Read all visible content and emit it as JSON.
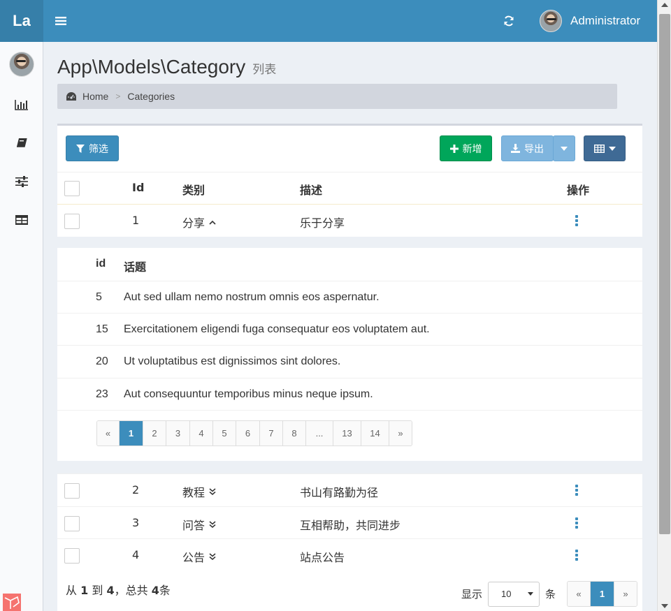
{
  "header": {
    "logo": "La",
    "user_name": "Administrator"
  },
  "sidebar": {
    "items": [
      {
        "icon": "bar-chart-icon"
      },
      {
        "icon": "book-icon"
      },
      {
        "icon": "sliders-icon"
      },
      {
        "icon": "table-icon"
      }
    ]
  },
  "page": {
    "title": "App\\Models\\Category",
    "subtitle": "列表"
  },
  "breadcrumb": {
    "home": "Home",
    "current": "Categories"
  },
  "toolbar": {
    "filter_label": "筛选",
    "new_label": "新增",
    "export_label": "导出"
  },
  "table": {
    "headers": {
      "id": "Id",
      "category": "类别",
      "description": "描述",
      "actions": "操作"
    },
    "rows": [
      {
        "id": "1",
        "category": "分享",
        "description": "乐于分享"
      },
      {
        "id": "2",
        "category": "教程",
        "description": "书山有路勤为径"
      },
      {
        "id": "3",
        "category": "问答",
        "description": "互相帮助，共同进步"
      },
      {
        "id": "4",
        "category": "公告",
        "description": "站点公告"
      }
    ]
  },
  "subtable": {
    "headers": {
      "id": "id",
      "topic": "话题"
    },
    "rows": [
      {
        "id": "5",
        "title": "Aut sed ullam nemo nostrum omnis eos aspernatur."
      },
      {
        "id": "15",
        "title": "Exercitationem eligendi fuga consequatur eos voluptatem aut."
      },
      {
        "id": "20",
        "title": "Ut voluptatibus est dignissimos sint dolores."
      },
      {
        "id": "23",
        "title": "Aut consequuntur temporibus minus neque ipsum."
      }
    ],
    "pages": [
      "«",
      "1",
      "2",
      "3",
      "4",
      "5",
      "6",
      "7",
      "8",
      "...",
      "13",
      "14",
      "»"
    ],
    "active_page": "1"
  },
  "footer": {
    "from_label": "从",
    "from": "1",
    "to_label": "到",
    "to": "4",
    "total_label": "，总共",
    "total": "4",
    "unit": "条",
    "show_label": "显示",
    "per_page": "10",
    "per_page_unit": "条",
    "pages": [
      "«",
      "1",
      "»"
    ]
  },
  "colors": {
    "primary": "#3c8dbc",
    "success": "#00a65a",
    "header_bg": "#3c8dbc"
  }
}
